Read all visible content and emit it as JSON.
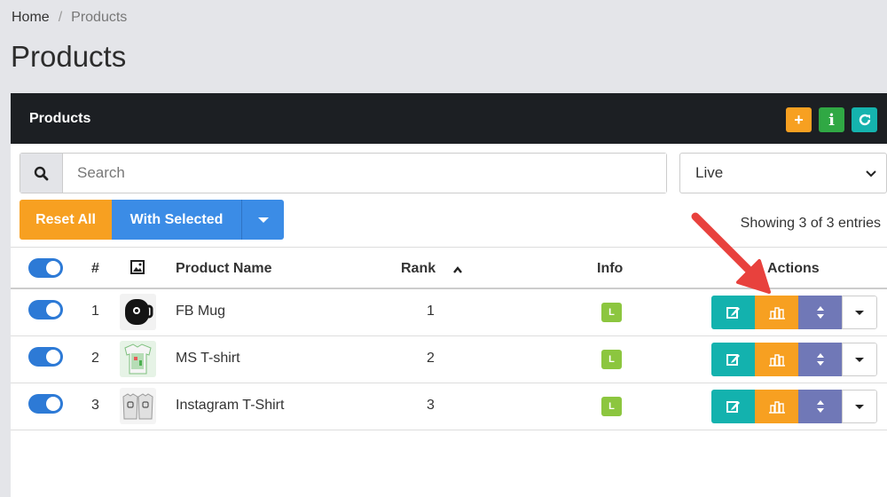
{
  "breadcrumb": {
    "home": "Home",
    "separator": "/",
    "current": "Products"
  },
  "page_title": "Products",
  "panel": {
    "title": "Products",
    "header_buttons": {
      "add": "+",
      "info": "i",
      "refresh": "C"
    }
  },
  "search": {
    "placeholder": "Search",
    "value": ""
  },
  "status_select": {
    "selected": "Live"
  },
  "buttons": {
    "reset_all": "Reset All",
    "with_selected": "With Selected"
  },
  "showing": "Showing 3 of 3 entries",
  "table": {
    "headers": {
      "number": "#",
      "product_name": "Product Name",
      "rank": "Rank",
      "info": "Info",
      "actions": "Actions"
    },
    "rows": [
      {
        "num": "1",
        "name": "FB Mug",
        "rank": "1",
        "info": "L"
      },
      {
        "num": "2",
        "name": "MS T-shirt",
        "rank": "2",
        "info": "L"
      },
      {
        "num": "3",
        "name": "Instagram T-Shirt",
        "rank": "3",
        "info": "L"
      }
    ]
  },
  "colors": {
    "orange": "#f7a021",
    "blue": "#3b8ce6",
    "teal": "#13b2ae",
    "purple": "#7078b7",
    "green_badge": "#8cc63f",
    "dark_header": "#1c1f23",
    "arrow_red": "#e8413d"
  }
}
